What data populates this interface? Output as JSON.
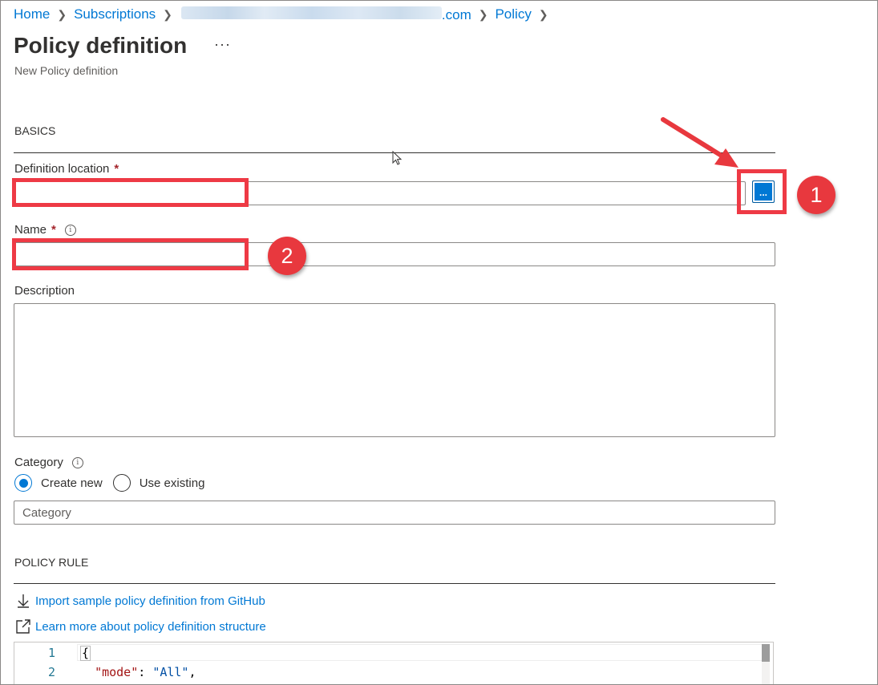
{
  "breadcrumb": {
    "home": "Home",
    "subscriptions": "Subscriptions",
    "account_suffix": ".com",
    "policy": "Policy"
  },
  "header": {
    "title": "Policy definition",
    "more": "···",
    "subtitle": "New Policy definition"
  },
  "basics": {
    "section_title": "BASICS",
    "definition_location_label": "Definition location",
    "definition_location_value": "",
    "browse_button_label": "...",
    "name_label": "Name",
    "name_value": "",
    "required_mark": "*",
    "info_glyph": "i",
    "description_label": "Description",
    "description_value": "",
    "category_label": "Category",
    "category_options": [
      "Create new",
      "Use existing"
    ],
    "category_selected": "Create new",
    "category_placeholder": "Category"
  },
  "policy_rule": {
    "section_title": "POLICY RULE",
    "import_link": "Import sample policy definition from GitHub",
    "learn_link": "Learn more about policy definition structure",
    "editor": {
      "line_numbers": [
        "1",
        "2"
      ],
      "line1": "{",
      "line2_key": "\"mode\"",
      "line2_colon": ": ",
      "line2_value": "\"All\"",
      "line2_comma": ","
    }
  },
  "annotations": {
    "badge_1": "1",
    "badge_2": "2",
    "highlight_color": "#ee3a45"
  },
  "colors": {
    "accent": "#0078d4",
    "required": "#a4262c",
    "text": "#323130"
  }
}
